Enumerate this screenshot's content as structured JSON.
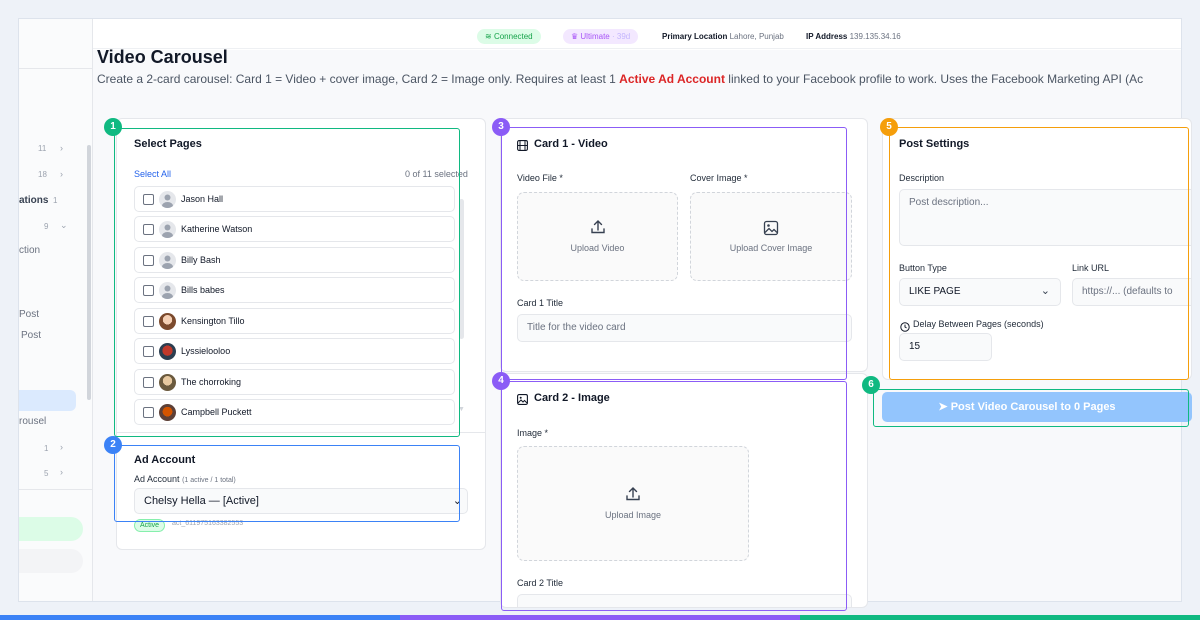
{
  "sidebar": {
    "counts": [
      "11",
      "18",
      "1",
      "9",
      "1",
      "5"
    ],
    "fragments": [
      "ations",
      "ction",
      "Post",
      "Post",
      "rousel"
    ]
  },
  "topbar": {
    "connected": "Connected",
    "plan": "Ultimate",
    "plan_days": "· 39d",
    "location_label": "Primary Location",
    "location_value": "Lahore, Punjab",
    "ip_label": "IP Address",
    "ip_value": "139.135.34.16"
  },
  "page": {
    "title": "Video Carousel",
    "desc_before": "Create a 2-card carousel: Card 1 = Video + cover image, Card 2 = Image only. Requires at least 1 ",
    "desc_highlight": "Active Ad Account",
    "desc_after": " linked to your Facebook profile to work. Uses the Facebook Marketing API (Ac"
  },
  "select_pages": {
    "title": "Select Pages",
    "select_all": "Select All",
    "selected_count": "0 of 11 selected",
    "pages": [
      {
        "name": "Jason Hall",
        "avatar": "default"
      },
      {
        "name": "Katherine Watson",
        "avatar": "default"
      },
      {
        "name": "Billy Bash",
        "avatar": "default"
      },
      {
        "name": "Bills babes",
        "avatar": "default"
      },
      {
        "name": "Kensington Tillo",
        "avatar": "photo"
      },
      {
        "name": "Lyssielooloo",
        "avatar": "photo"
      },
      {
        "name": "The chorroking",
        "avatar": "photo"
      },
      {
        "name": "Campbell Puckett",
        "avatar": "photo"
      }
    ]
  },
  "ad_account": {
    "title": "Ad Account",
    "label": "Ad Account",
    "meta": "(1 active / 1 total)",
    "selected": "Chelsy Hella — [Active]",
    "status_badge": "Active",
    "account_id": "act_611975163382553"
  },
  "card1": {
    "title": "Card 1 - Video",
    "video_label": "Video File *",
    "cover_label": "Cover Image *",
    "upload_video": "Upload Video",
    "upload_cover": "Upload Cover Image",
    "card_title_label": "Card 1 Title",
    "card_title_placeholder": "Title for the video card"
  },
  "card2": {
    "title": "Card 2 - Image",
    "image_label": "Image *",
    "upload_image": "Upload Image",
    "card_title_label": "Card 2 Title"
  },
  "post_settings": {
    "title": "Post Settings",
    "description_label": "Description",
    "description_placeholder": "Post description...",
    "button_type_label": "Button Type",
    "button_type_value": "LIKE PAGE",
    "link_url_label": "Link URL",
    "link_url_placeholder": "https://... (defaults to",
    "delay_label": "Delay Between Pages (seconds)",
    "delay_value": "15"
  },
  "submit": {
    "label": "Post Video Carousel to 0 Pages"
  },
  "callouts": [
    "1",
    "2",
    "3",
    "4",
    "5",
    "6"
  ],
  "colors": {
    "green": "#10b981",
    "blue": "#3b82f6",
    "purple": "#8b5cf6",
    "orange": "#f59e0b",
    "red_highlight": "#dc2626",
    "submit_button": "#93c5fd"
  }
}
